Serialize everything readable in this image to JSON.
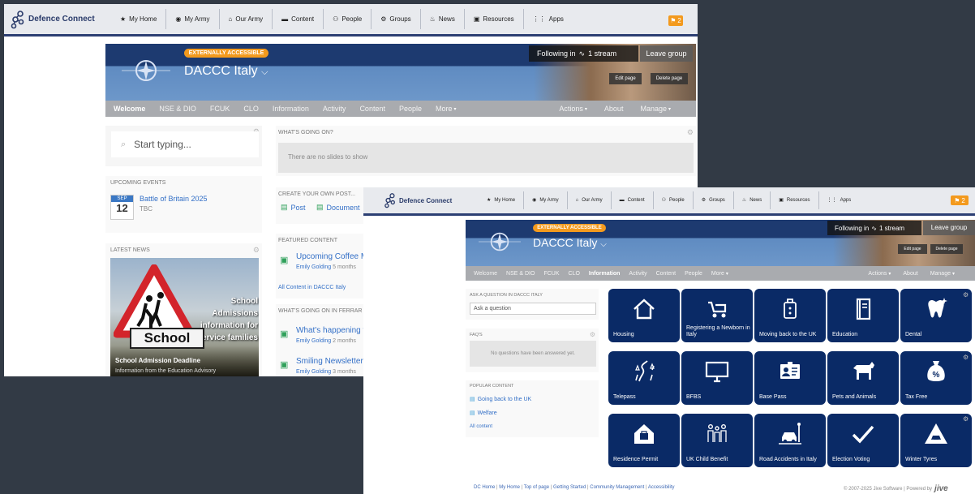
{
  "nav": {
    "brand": "Defence Connect",
    "items": [
      {
        "label": "My Home",
        "icon": "star-icon",
        "glyph": "★"
      },
      {
        "label": "My Army",
        "icon": "user-circle-icon",
        "glyph": "◉"
      },
      {
        "label": "Our Army",
        "icon": "building-icon",
        "glyph": "⌂"
      },
      {
        "label": "Content",
        "icon": "folder-icon",
        "glyph": "▬"
      },
      {
        "label": "People",
        "icon": "people-icon",
        "glyph": "⚇"
      },
      {
        "label": "Groups",
        "icon": "groups-icon",
        "glyph": "⚙"
      },
      {
        "label": "News",
        "icon": "news-icon",
        "glyph": "♨"
      },
      {
        "label": "Resources",
        "icon": "briefcase-icon",
        "glyph": "▣"
      },
      {
        "label": "Apps",
        "icon": "grid-icon",
        "glyph": "⋮⋮"
      }
    ],
    "notification_count": "2"
  },
  "group": {
    "badge": "EXTERNALLY ACCESSIBLE",
    "title": "DACCC Italy",
    "following": "Following in",
    "stream": "1 stream",
    "leave": "Leave group",
    "edit": "Edit page",
    "delete": "Delete page"
  },
  "tabs_back": [
    "Welcome",
    "NSE & DIO",
    "FCUK",
    "CLO",
    "Information",
    "Activity",
    "Content",
    "People",
    "More"
  ],
  "tabs_front": [
    "Welcome",
    "NSE & DIO",
    "FCUK",
    "CLO",
    "Information",
    "Activity",
    "Content",
    "People",
    "More"
  ],
  "tabs_right": [
    "Actions",
    "About",
    "Manage"
  ],
  "back": {
    "search_placeholder": "Start typing...",
    "whats_going_on": "WHAT'S GOING ON?",
    "no_slides": "There are no slides to show",
    "upcoming_events": "UPCOMING EVENTS",
    "event": {
      "month": "SEP",
      "day": "12",
      "title": "Battle of Britain 2025",
      "time": "TBC"
    },
    "create_post": "CREATE YOUR OWN POST...",
    "post": "Post",
    "document": "Document",
    "featured": "FEATURED CONTENT",
    "featured_item": {
      "title": "Upcoming Coffee M",
      "author": "Emily Golding",
      "age": "5 months"
    },
    "all_content": "All Content in DACCC Italy",
    "latest_news": "LATEST NEWS",
    "news_caption": "School Admission Deadline",
    "news_sub": "Information from the Education Advisory",
    "sign_top": "School Admissions information for Service families",
    "sign_bottom": "School",
    "whats_going_ferrara": "WHAT'S GOING ON IN FERRAR",
    "ferrara_items": [
      {
        "title": "What's happening t",
        "author": "Emily Golding",
        "age": "2 months"
      },
      {
        "title": "Smiling Newsletter",
        "author": "Emily Golding",
        "age": "3 months"
      }
    ]
  },
  "front": {
    "ask_head": "ASK A QUESTION IN DACCC ITALY",
    "ask_placeholder": "Ask a question",
    "faqs": "FAQ'S",
    "no_questions": "No questions have been answered yet.",
    "popular": "POPULAR CONTENT",
    "popular_items": [
      "Going back to the UK",
      "Welfare"
    ],
    "all_content": "All content",
    "tiles": [
      {
        "label": "Housing",
        "icon": "house-icon"
      },
      {
        "label": "Registering a Newborn in Italy",
        "icon": "pram-icon"
      },
      {
        "label": "Moving back to the UK",
        "icon": "luggage-icon"
      },
      {
        "label": "Education",
        "icon": "book-icon"
      },
      {
        "label": "Dental",
        "icon": "tooth-icon"
      },
      {
        "label": "Telepass",
        "icon": "road-icon"
      },
      {
        "label": "BFBS",
        "icon": "tv-icon"
      },
      {
        "label": "Base Pass",
        "icon": "id-card-icon"
      },
      {
        "label": "Pets and Animals",
        "icon": "dog-icon"
      },
      {
        "label": "Tax Free",
        "icon": "money-bag-icon"
      },
      {
        "label": "Residence Permit",
        "icon": "home-badge-icon"
      },
      {
        "label": "UK Child Benefit",
        "icon": "family-icon"
      },
      {
        "label": "Road Accidents in Italy",
        "icon": "car-crash-icon"
      },
      {
        "label": "Election Voting",
        "icon": "checkmark-icon"
      },
      {
        "label": "Winter Tyres",
        "icon": "warning-car-icon"
      }
    ],
    "footer_links": [
      "DC Home",
      "My Home",
      "Top of page",
      "Getting Started",
      "Community Management",
      "Accessibility"
    ],
    "copyright": "© 2007-2025 Jive Software  |  Powered by",
    "jive": "jive"
  }
}
